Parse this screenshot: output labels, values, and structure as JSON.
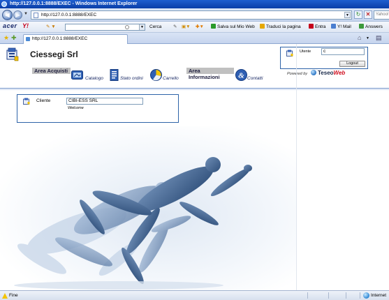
{
  "window": {
    "title": "http://127.0.0.1:8888/EXEC - Windows Internet Explorer"
  },
  "browser": {
    "address": "http://127.0.0.1:8888/EXEC",
    "search_placeholder": "Yahoo!",
    "toolbar": {
      "brand": "acer",
      "yahoo": "Y!",
      "search_button": "Cerca",
      "salva": "Salva sul Mio Web",
      "traduci": "Traduci la pagina",
      "entra": "Entra",
      "ymail": "Y! Mail",
      "answers": "Answers"
    },
    "tab": {
      "title": "http://127.0.0.1:8888/EXEC"
    }
  },
  "header": {
    "company": "Ciessegi Srl",
    "user": {
      "label": "Utente",
      "value": "c",
      "logout": "Logout"
    },
    "powered_by": "Powered by",
    "teseo_brand": "Teseo",
    "teseo_web": "Web"
  },
  "menu": {
    "area_acquisti": "Area Acquisti",
    "catalogo": "Catalogo",
    "stato_ordini": "Stato ordini",
    "carrello": "Carrello",
    "area_informazioni": "Area Informazioni",
    "contatti": "Contatti"
  },
  "client": {
    "label": "Cliente",
    "value": "CIBI-ESS SRL",
    "welcome": "Welcome"
  },
  "statusbar": {
    "status": "Fine",
    "zone": "Internet"
  }
}
